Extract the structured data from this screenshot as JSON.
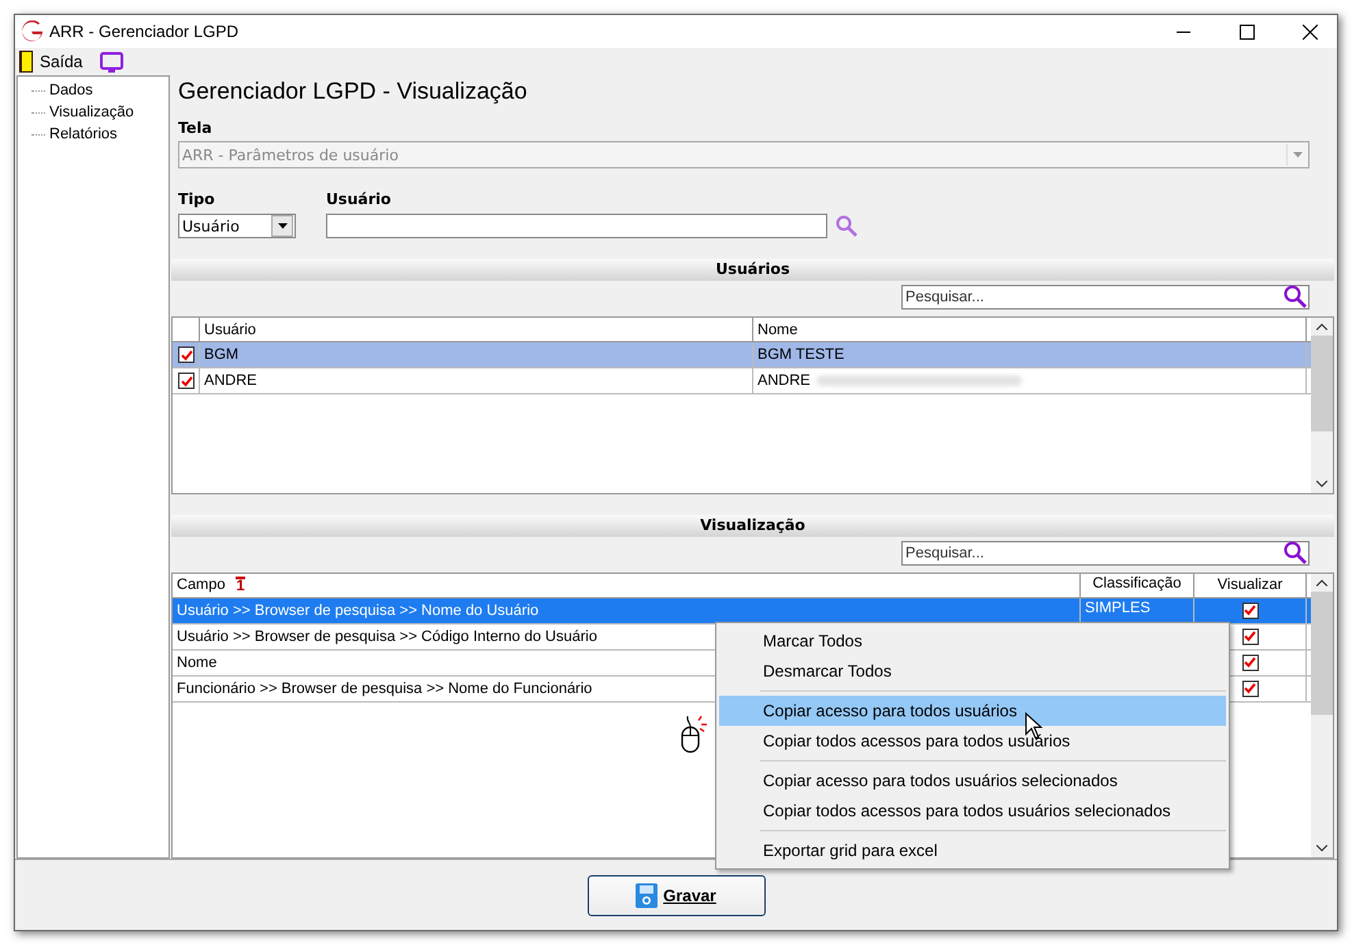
{
  "window": {
    "title": "ARR - Gerenciador LGPD"
  },
  "toolbar": {
    "exit_label": "Saída"
  },
  "sidebar": {
    "items": [
      {
        "label": "Dados",
        "selected": false
      },
      {
        "label": "Visualização",
        "selected": false
      },
      {
        "label": "Relatórios",
        "selected": false
      }
    ]
  },
  "heading": "Gerenciador LGPD - Visualização",
  "tela": {
    "label": "Tela",
    "value": "ARR - Parâmetros de usuário",
    "disabled": true
  },
  "tipo": {
    "label": "Tipo",
    "value": "Usuário"
  },
  "usuario": {
    "label": "Usuário"
  },
  "users_section": {
    "title": "Usuários",
    "search_placeholder": "Pesquisar...",
    "columns": [
      "Usuário",
      "Nome"
    ],
    "rows": [
      {
        "checked": true,
        "selected": true,
        "cells": [
          "BGM",
          "BGM TESTE"
        ],
        "redacted": false
      },
      {
        "checked": true,
        "selected": false,
        "cells": [
          "ANDRE",
          "ANDRE"
        ],
        "redacted": true
      }
    ]
  },
  "view_section": {
    "title": "Visualização",
    "search_placeholder": "Pesquisar...",
    "columns": [
      {
        "label": "Campo",
        "sort_mark": "1"
      },
      {
        "label": "Classificação"
      },
      {
        "label": "Visualizar"
      }
    ],
    "rows": [
      {
        "campo": "Usuário >> Browser de pesquisa >> Nome do Usuário",
        "classificacao": "SIMPLES",
        "checked": true,
        "selected": true
      },
      {
        "campo": "Usuário >> Browser de pesquisa >> Código Interno do Usuário",
        "checked": true,
        "selected": false
      },
      {
        "campo": "Nome",
        "checked": true,
        "selected": false
      },
      {
        "campo": "Funcionário >> Browser de pesquisa >> Nome do Funcionário",
        "checked": true,
        "selected": false
      }
    ]
  },
  "context_menu": {
    "items": [
      {
        "kind": "item",
        "label": "Marcar Todos",
        "selected": false
      },
      {
        "kind": "item",
        "label": "Desmarcar Todos",
        "selected": false
      },
      {
        "kind": "separator"
      },
      {
        "kind": "item",
        "label": "Copiar acesso para todos usuários",
        "selected": true
      },
      {
        "kind": "item",
        "label": "Copiar todos acessos para todos usuários",
        "selected": false
      },
      {
        "kind": "separator"
      },
      {
        "kind": "item",
        "label": "Copiar acesso para todos usuários selecionados",
        "selected": false
      },
      {
        "kind": "item",
        "label": "Copiar todos acessos para todos usuários selecionados",
        "selected": false
      },
      {
        "kind": "separator"
      },
      {
        "kind": "item",
        "label": "Exportar grid para excel",
        "selected": false
      }
    ]
  },
  "save_button": {
    "label": "Gravar"
  }
}
